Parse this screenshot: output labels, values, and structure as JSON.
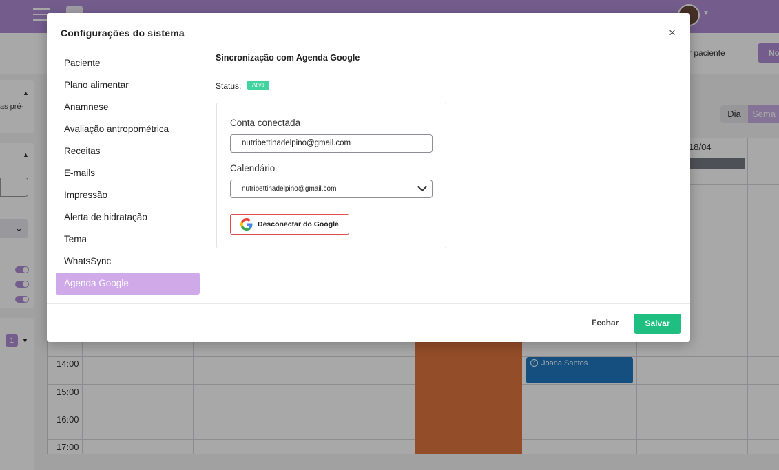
{
  "background": {
    "add_patient_label": "onar paciente",
    "new_button_label": "No",
    "left_panel": {
      "text_fragment": "as pré-",
      "badge_count": "1"
    },
    "view_toggle": {
      "day_label": "Dia",
      "week_label": "Sema"
    },
    "calendar": {
      "header_date": "18/04",
      "times": [
        "14:00",
        "15:00",
        "16:00",
        "17:00"
      ],
      "event_blue_title": "Joana Santos"
    }
  },
  "modal": {
    "title": "Configurações do sistema",
    "close_glyph": "×",
    "menu": [
      {
        "label": "Paciente"
      },
      {
        "label": "Plano alimentar"
      },
      {
        "label": "Anamnese"
      },
      {
        "label": "Avaliação antropométrica"
      },
      {
        "label": "Receitas"
      },
      {
        "label": "E-mails"
      },
      {
        "label": "Impressão"
      },
      {
        "label": "Alerta de hidratação"
      },
      {
        "label": "Tema"
      },
      {
        "label": "WhatsSync"
      },
      {
        "label": "Agenda Google",
        "active": true
      }
    ],
    "content": {
      "section_title": "Sincronização com Agenda Google",
      "status_label": "Status:",
      "status_value": "Ativo",
      "status_color": "#43d39e",
      "connected_account_label": "Conta conectada",
      "connected_account_value": "nutribettinadelpino@gmail.com",
      "calendar_label": "Calendário",
      "calendar_selected": "nutribettinadelpino@gmail.com",
      "disconnect_button_label": "Desconectar do Google"
    },
    "footer": {
      "close_label": "Fechar",
      "save_label": "Salvar",
      "save_color": "#1fbf82"
    }
  },
  "colors": {
    "brand": "#b08ed6",
    "active_menu": "#cfa9e8"
  }
}
